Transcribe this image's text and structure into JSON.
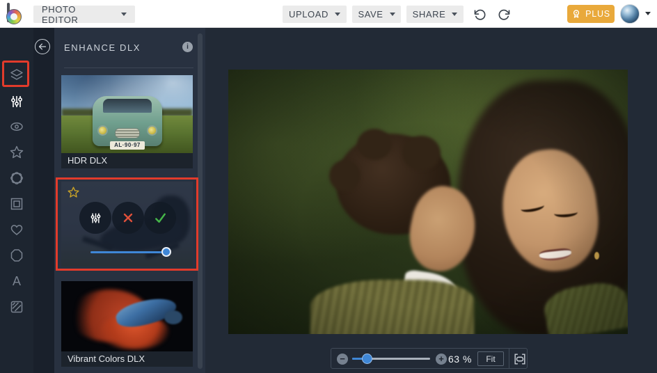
{
  "topbar": {
    "photo_editor_label": "PHOTO EDITOR",
    "upload_label": "UPLOAD",
    "save_label": "SAVE",
    "share_label": "SHARE",
    "plus_label": "PLUS"
  },
  "sidebar": {
    "items": [
      {
        "name": "layers",
        "active": false
      },
      {
        "name": "adjust-sliders",
        "active": true,
        "annotated": true
      },
      {
        "name": "effects-eye",
        "active": false
      },
      {
        "name": "star-effects",
        "active": false
      },
      {
        "name": "artsy-flower",
        "active": false
      },
      {
        "name": "frames",
        "active": false
      },
      {
        "name": "overlays-heart",
        "active": false
      },
      {
        "name": "graphics-badge",
        "active": false
      },
      {
        "name": "text",
        "active": false
      },
      {
        "name": "textures",
        "active": false
      }
    ]
  },
  "panel": {
    "title": "ENHANCE DLX",
    "thumbnails": [
      {
        "label": "HDR DLX",
        "license_plate": "AL·90·97",
        "selected": false
      },
      {
        "label": "",
        "selected": true,
        "controls": [
          "adjust",
          "cancel",
          "apply"
        ],
        "favorite_star": true,
        "slider_position": 0.93
      },
      {
        "label": "Vibrant Colors DLX",
        "selected": false
      }
    ]
  },
  "canvas": {
    "zoom_percent": "63 %",
    "fit_label": "Fit"
  },
  "colors": {
    "annotation_red": "#e23b2b",
    "plus_gold": "#e9a93b",
    "slider_blue": "#3f87d6",
    "apply_green": "#45b649",
    "cancel_red": "#e0503a",
    "topbar_bg": "#ffffff",
    "sidebar_bg": "#1d2530",
    "panel_bg": "#283140",
    "canvas_bg": "#222a36"
  }
}
